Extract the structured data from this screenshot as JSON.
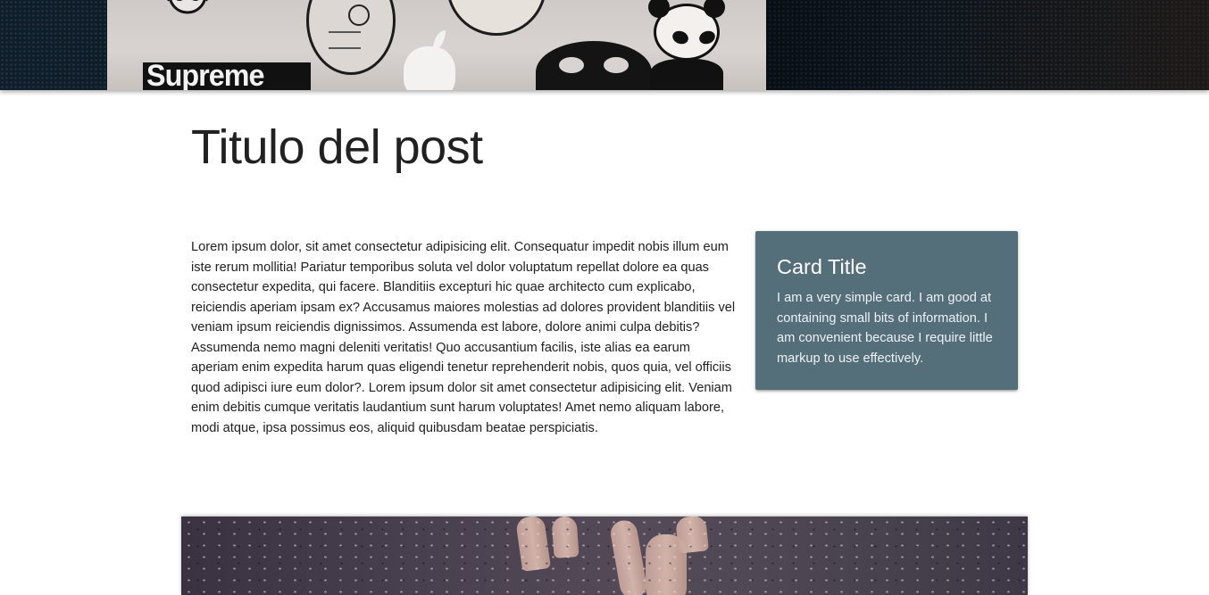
{
  "hero": {
    "image_label": "Supreme"
  },
  "post": {
    "title": "Titulo del post",
    "body": "Lorem ipsum dolor, sit amet consectetur adipisicing elit. Consequatur impedit nobis illum eum iste rerum mollitia! Pariatur temporibus soluta vel dolor voluptatum repellat dolore ea quas consectetur expedita, qui facere. Blanditiis excepturi hic quae architecto cum explicabo, reiciendis aperiam ipsam ex? Accusamus maiores molestias ad dolores provident blanditiis vel veniam ipsum reiciendis dignissimos. Assumenda est labore, dolore animi culpa debitis? Assumenda nemo magni deleniti veritatis! Quo accusantium facilis, iste alias ea earum aperiam enim expedita harum quas eligendi tenetur reprehenderit nobis, quos quia, vel officiis quod adipisci iure eum dolor?. Lorem ipsum dolor sit amet consectetur adipisicing elit. Veniam enim debitis cumque veritatis laudantium sunt harum voluptates! Amet nemo aliquam labore, modi atque, ipsa possimus eos, aliquid quibusdam beatae perspiciatis."
  },
  "card": {
    "title": "Card Title",
    "text": "I am a very simple card. I am good at containing small bits of information. I am convenient because I require little markup to use effectively.",
    "background_color": "#546e7a"
  }
}
